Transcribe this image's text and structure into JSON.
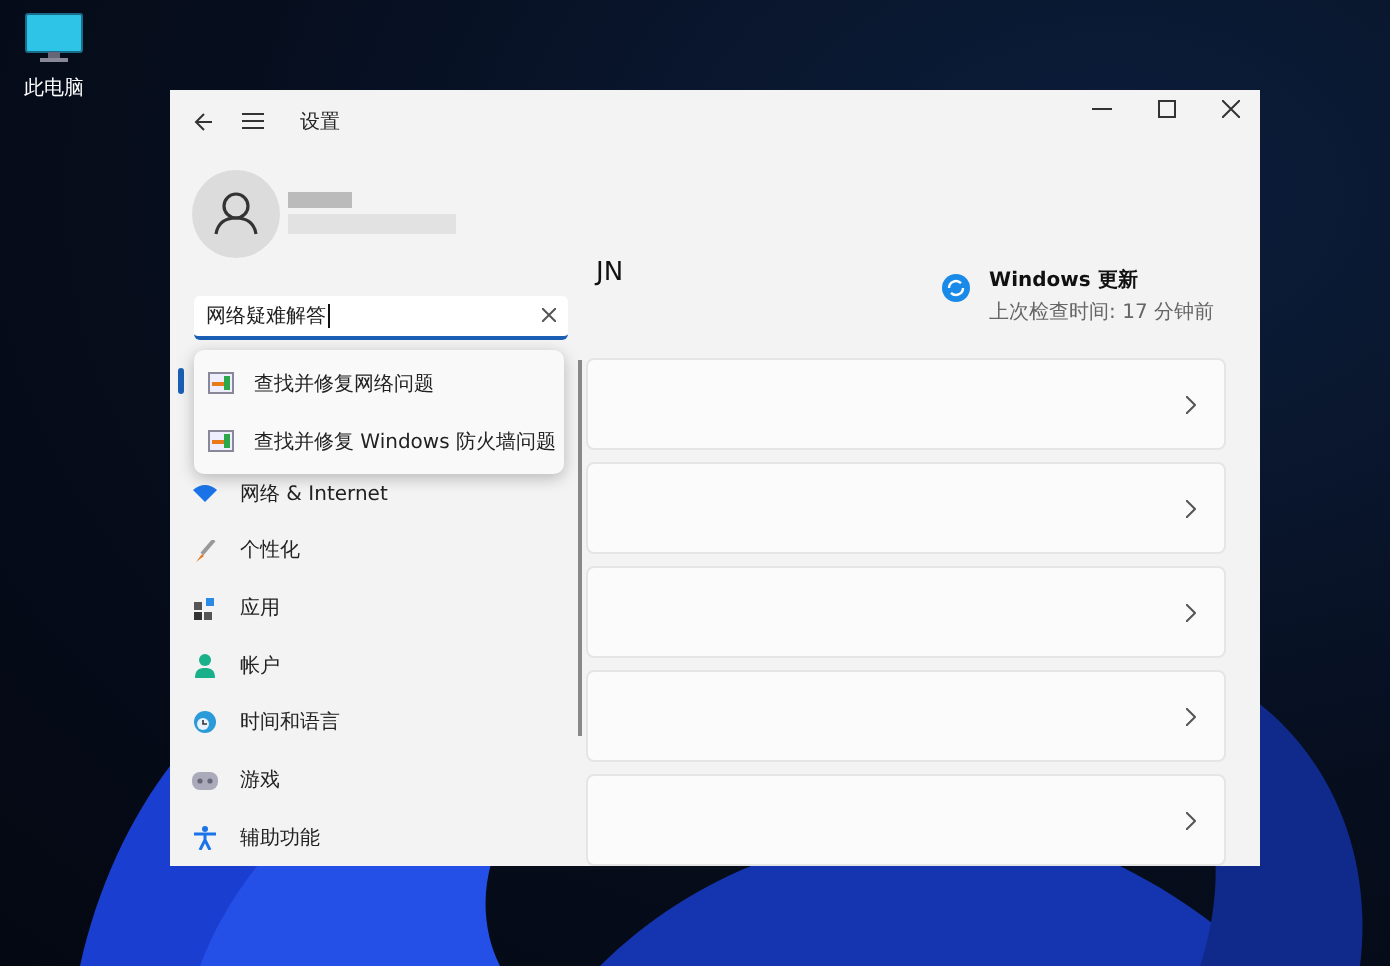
{
  "desktop_icon": {
    "label": "此电脑"
  },
  "window": {
    "title": "设置"
  },
  "account": {
    "short_name": "JN"
  },
  "search": {
    "value": "网络疑难解答"
  },
  "suggestions": [
    {
      "label": "查找并修复网络问题"
    },
    {
      "label": "查找并修复 Windows 防火墙问题"
    }
  ],
  "sidebar": {
    "items": [
      {
        "label": "网络 & Internet",
        "kind": "wifi"
      },
      {
        "label": "个性化",
        "kind": "brush"
      },
      {
        "label": "应用",
        "kind": "apps"
      },
      {
        "label": "帐户",
        "kind": "person"
      },
      {
        "label": "时间和语言",
        "kind": "clock"
      },
      {
        "label": "游戏",
        "kind": "gamepad"
      },
      {
        "label": "辅助功能",
        "kind": "accessibility"
      }
    ]
  },
  "update": {
    "title": "Windows 更新",
    "subtitle": "上次检查时间: 17 分钟前"
  }
}
